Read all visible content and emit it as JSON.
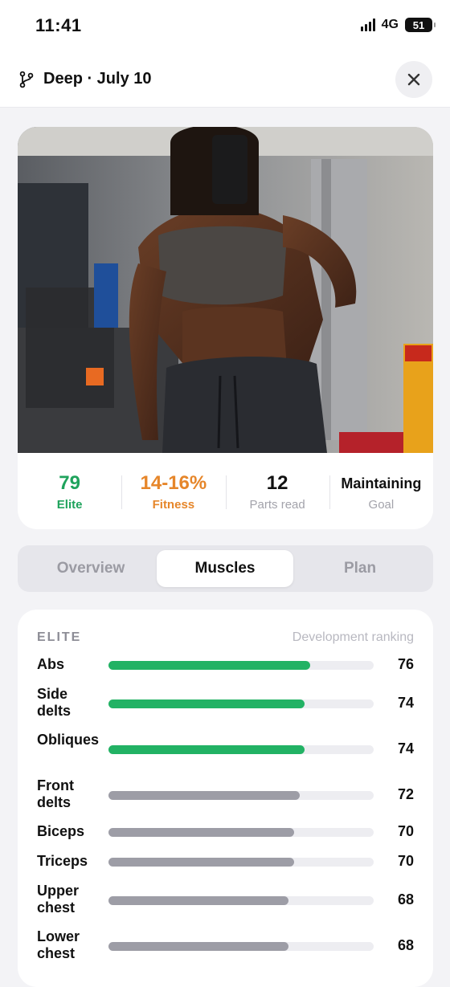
{
  "status_bar": {
    "time": "11:41",
    "network": "4G",
    "battery": "51"
  },
  "nav": {
    "title": "Deep · July 10",
    "branch_icon": "branch-icon",
    "close_icon": "close-icon"
  },
  "photo": {
    "description_icon": "gym-selfie-photo"
  },
  "stats": [
    {
      "value": "79",
      "label": "Elite",
      "color": "#1fa35c"
    },
    {
      "value": "14-16%",
      "label": "Fitness",
      "color": "#e6862a"
    },
    {
      "value": "12",
      "label": "Parts read",
      "color": "#111111"
    },
    {
      "value": "Maintaining",
      "label": "Goal",
      "color": "#111111"
    }
  ],
  "tabs": [
    {
      "label": "Overview",
      "active": false
    },
    {
      "label": "Muscles",
      "active": true
    },
    {
      "label": "Plan",
      "active": false
    }
  ],
  "muscles": {
    "tier": "ELITE",
    "note": "Development ranking",
    "colors": {
      "elite": "#22b264",
      "normal": "#9d9da6",
      "track": "#ededf1"
    },
    "rows": [
      {
        "name": "Abs",
        "value": "76",
        "score": 76,
        "level": "elite"
      },
      {
        "name": "Side delts",
        "value": "74",
        "score": 74,
        "level": "elite"
      },
      {
        "name": "Obliques",
        "value": "74",
        "score": 74,
        "level": "elite"
      },
      {
        "name": "Front delts",
        "value": "72",
        "score": 72,
        "level": "normal"
      },
      {
        "name": "Biceps",
        "value": "70",
        "score": 70,
        "level": "normal"
      },
      {
        "name": "Triceps",
        "value": "70",
        "score": 70,
        "level": "normal"
      },
      {
        "name": "Upper chest",
        "value": "68",
        "score": 68,
        "level": "normal"
      },
      {
        "name": "Lower chest",
        "value": "68",
        "score": 68,
        "level": "normal"
      }
    ]
  }
}
